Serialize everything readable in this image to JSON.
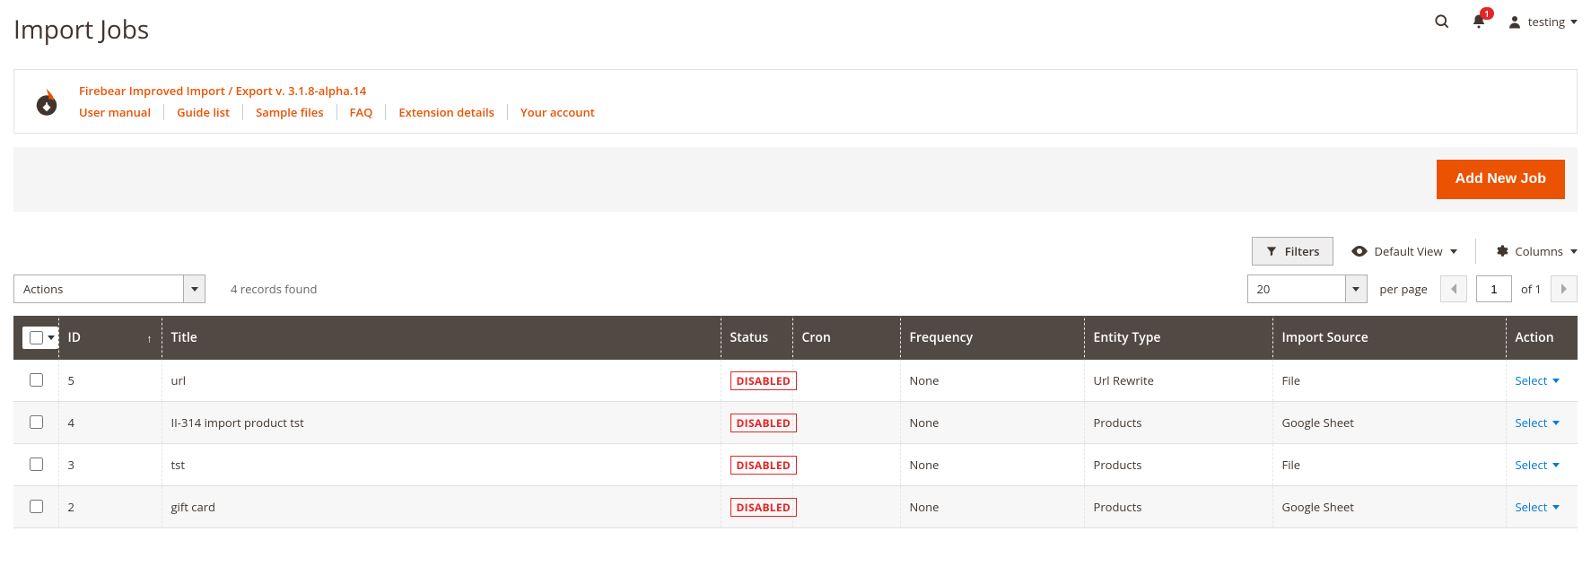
{
  "header": {
    "title": "Import Jobs",
    "notifications_count": "1",
    "user_name": "testing"
  },
  "info": {
    "title": "Firebear Improved Import / Export v. 3.1.8-alpha.14",
    "links": [
      "User manual",
      "Guide list",
      "Sample files",
      "FAQ",
      "Extension details",
      "Your account"
    ]
  },
  "primary_action": "Add New Job",
  "toolbar": {
    "filters": "Filters",
    "default_view": "Default View",
    "columns": "Columns"
  },
  "grid": {
    "actions_label": "Actions",
    "records_found": "4 records found",
    "per_page_value": "20",
    "per_page_label": "per page",
    "page_value": "1",
    "page_total": "of 1",
    "columns": {
      "id": "ID",
      "title": "Title",
      "status": "Status",
      "cron": "Cron",
      "frequency": "Frequency",
      "entity": "Entity Type",
      "source": "Import Source",
      "action": "Action"
    },
    "select_label": "Select",
    "rows": [
      {
        "id": "5",
        "title": "url",
        "status": "DISABLED",
        "cron": "",
        "frequency": "None",
        "entity": "Url Rewrite",
        "source": "File"
      },
      {
        "id": "4",
        "title": "II-314 import product tst",
        "status": "DISABLED",
        "cron": "",
        "frequency": "None",
        "entity": "Products",
        "source": "Google Sheet"
      },
      {
        "id": "3",
        "title": "tst",
        "status": "DISABLED",
        "cron": "",
        "frequency": "None",
        "entity": "Products",
        "source": "File"
      },
      {
        "id": "2",
        "title": "gift card",
        "status": "DISABLED",
        "cron": "",
        "frequency": "None",
        "entity": "Products",
        "source": "Google Sheet"
      }
    ]
  }
}
